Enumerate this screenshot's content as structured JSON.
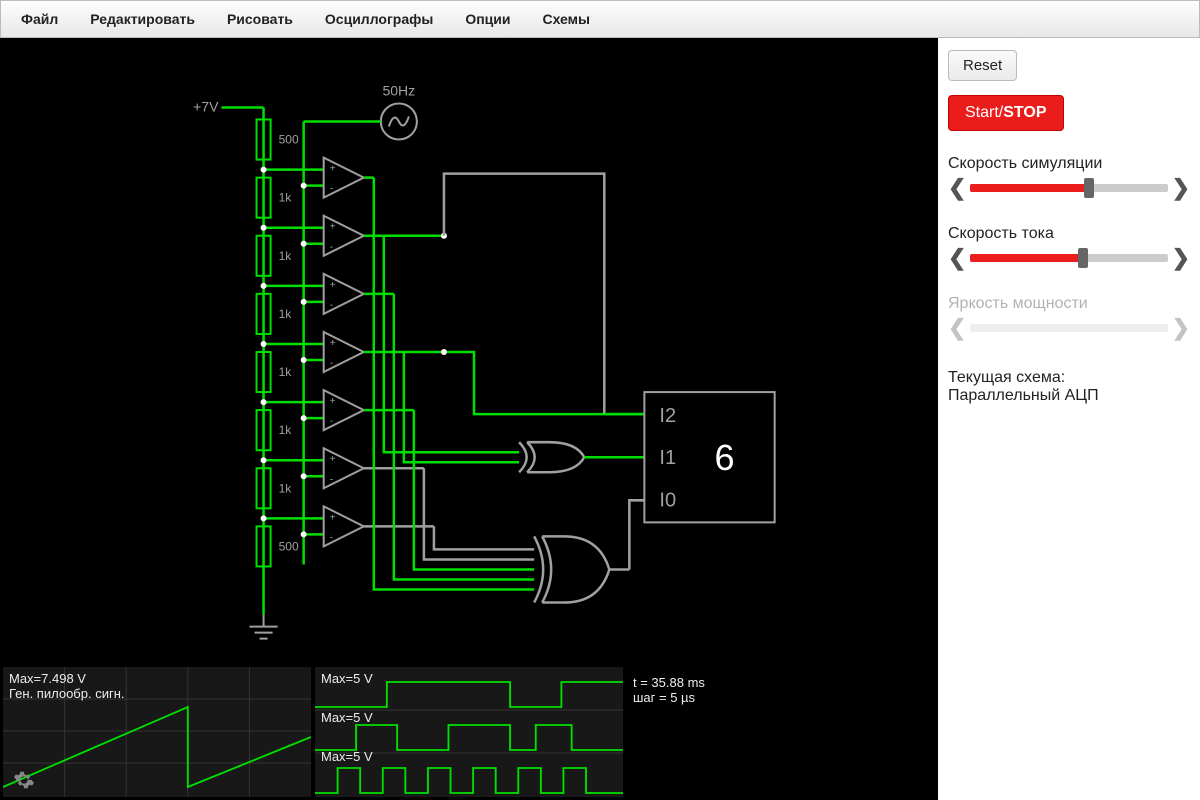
{
  "menubar": [
    "Файл",
    "Редактировать",
    "Рисовать",
    "Осциллографы",
    "Опции",
    "Схемы"
  ],
  "sidebar": {
    "reset_label": "Reset",
    "startstop_prefix": "Start/",
    "startstop_bold": "STOP",
    "sliders": [
      {
        "label": "Скорость симуляции",
        "value_pct": 60,
        "enabled": true
      },
      {
        "label": "Скорость тока",
        "value_pct": 57,
        "enabled": true
      },
      {
        "label": "Яркость мощности",
        "value_pct": 0,
        "enabled": false
      }
    ],
    "current_scheme_label": "Текущая схема:",
    "current_scheme_name": "Параллельный АЦП"
  },
  "circuit": {
    "voltage_label": "+7V",
    "freq_label": "50Hz",
    "resistor_labels": [
      "500",
      "1k",
      "1k",
      "1k",
      "1k",
      "1k",
      "1k",
      "500"
    ],
    "chip": {
      "inputs": [
        "I2",
        "I1",
        "I0"
      ],
      "display_value": "6"
    }
  },
  "scopes": {
    "left": {
      "max_label": "Max=7.498 V",
      "name": "Ген. пилообр. сигн."
    },
    "center": {
      "labels": [
        "Max=5 V",
        "Max=5 V",
        "Max=5 V"
      ]
    },
    "right": {
      "time_label": "t = 35.88 ms",
      "step_label": "шаг = 5 µs"
    }
  },
  "colors": {
    "wire_active": "#00e000",
    "wire_idle": "#a0a0a0",
    "node": "#ffffff"
  }
}
